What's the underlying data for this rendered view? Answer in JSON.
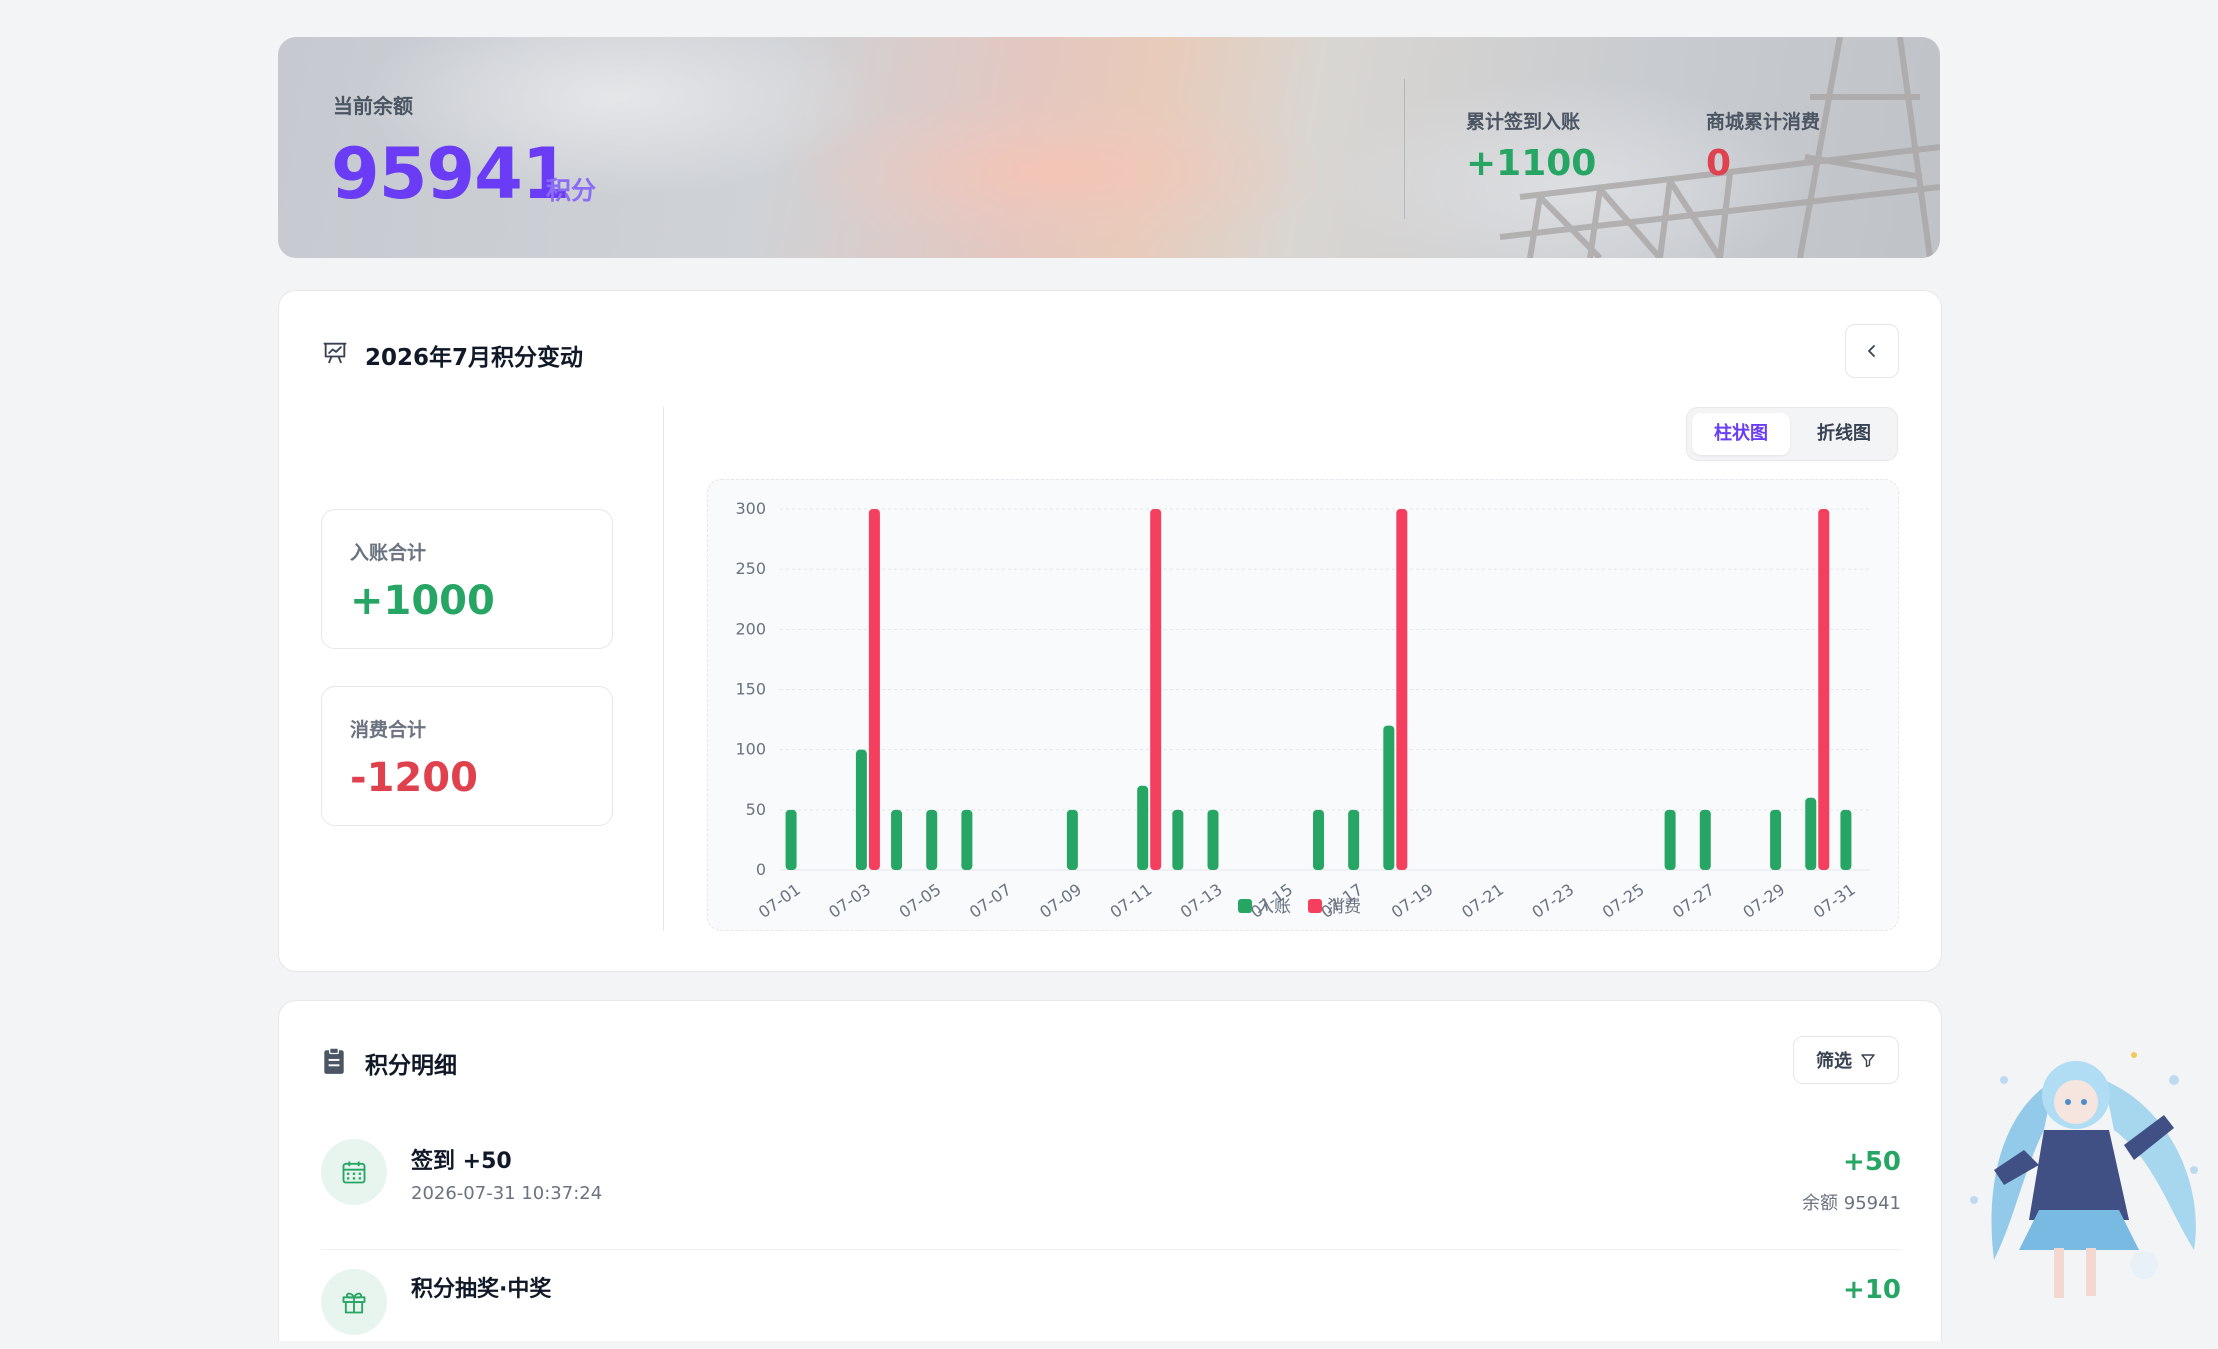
{
  "banner": {
    "balance_label": "当前余额",
    "balance": "95941",
    "balance_unit": "积分",
    "checkin_label": "累计签到入账",
    "checkin_value": "+1100",
    "shop_label": "商城累计消费",
    "shop_value": "0"
  },
  "monthly": {
    "title": "2026年7月积分变动",
    "income_label": "入账合计",
    "income_value": "+1000",
    "expense_label": "消费合计",
    "expense_value": "-1200",
    "toggle": {
      "bar": "柱状图",
      "line": "折线图",
      "active": "bar"
    }
  },
  "chart_data": {
    "type": "bar",
    "ylim": [
      0,
      300
    ],
    "yticks": [
      "0",
      "50",
      "100",
      "150",
      "200",
      "250",
      "300"
    ],
    "categories": [
      "07-01",
      "07-02",
      "07-03",
      "07-04",
      "07-05",
      "07-06",
      "07-07",
      "07-08",
      "07-09",
      "07-10",
      "07-11",
      "07-12",
      "07-13",
      "07-14",
      "07-15",
      "07-16",
      "07-17",
      "07-18",
      "07-19",
      "07-20",
      "07-21",
      "07-22",
      "07-23",
      "07-24",
      "07-25",
      "07-26",
      "07-27",
      "07-28",
      "07-29",
      "07-30",
      "07-31"
    ],
    "xticks": [
      "07-01",
      "07-03",
      "07-05",
      "07-07",
      "07-09",
      "07-11",
      "07-13",
      "07-15",
      "07-17",
      "07-19",
      "07-21",
      "07-23",
      "07-25",
      "07-27",
      "07-29",
      "07-31"
    ],
    "series": [
      {
        "name": "入账",
        "color": "#27a564",
        "values": [
          50,
          0,
          100,
          50,
          50,
          50,
          0,
          0,
          50,
          0,
          70,
          50,
          50,
          0,
          0,
          50,
          50,
          120,
          0,
          0,
          0,
          0,
          0,
          0,
          0,
          50,
          50,
          0,
          50,
          60,
          50
        ]
      },
      {
        "name": "消费",
        "color": "#f43f5e",
        "values": [
          0,
          0,
          300,
          0,
          0,
          0,
          0,
          0,
          0,
          0,
          300,
          0,
          0,
          0,
          0,
          0,
          0,
          300,
          0,
          0,
          0,
          0,
          0,
          0,
          0,
          0,
          0,
          0,
          0,
          300,
          0
        ]
      }
    ],
    "legend": "bottom-center",
    "grid": true
  },
  "details": {
    "title": "积分明细",
    "filter_label": "筛选",
    "items": [
      {
        "title": "签到 +50",
        "time": "2026-07-31 10:37:24",
        "amount": "+50",
        "balance": "余额 95941",
        "icon": "calendar-icon"
      },
      {
        "title": "积分抽奖·中奖",
        "amount": "+10",
        "icon": "gift-icon"
      }
    ]
  },
  "colors": {
    "accent": "#6a3cf5",
    "income": "#27a564",
    "expense": "#e0414f"
  }
}
